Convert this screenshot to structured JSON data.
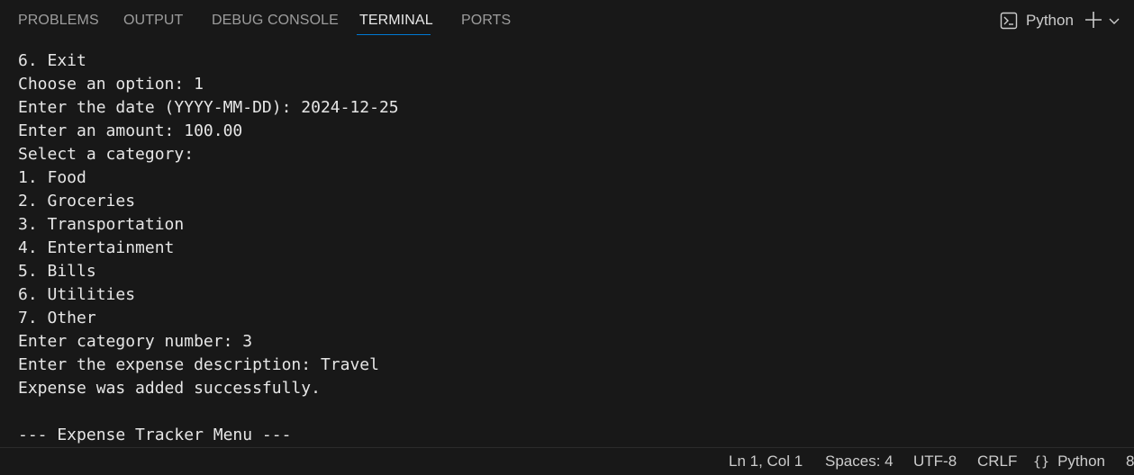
{
  "panel": {
    "tabs": [
      {
        "label": "PROBLEMS"
      },
      {
        "label": "OUTPUT"
      },
      {
        "label": "DEBUG CONSOLE"
      },
      {
        "label": "TERMINAL"
      },
      {
        "label": "PORTS"
      }
    ],
    "active_tab": "TERMINAL",
    "terminal_name": "Python",
    "terminal_icon": "terminal-icon",
    "add_icon": "plus-icon",
    "dropdown_icon": "chevron-down-icon"
  },
  "terminal": {
    "lines": [
      "6. Exit",
      "Choose an option: 1",
      "Enter the date (YYYY-MM-DD): 2024-12-25",
      "Enter an amount: 100.00",
      "Select a category:",
      "1. Food",
      "2. Groceries",
      "3. Transportation",
      "4. Entertainment",
      "5. Bills",
      "6. Utilities",
      "7. Other",
      "Enter category number: 3",
      "Enter the expense description: Travel",
      "Expense was added successfully.",
      "",
      "--- Expense Tracker Menu ---"
    ]
  },
  "status_bar": {
    "position": "Ln 1, Col 1",
    "spaces": "Spaces: 4",
    "encoding": "UTF-8",
    "eol": "CRLF",
    "language_icon": "{}",
    "language": "Python",
    "overflow_glyph": "8"
  },
  "colors": {
    "background": "#181818",
    "accent": "#0078d4",
    "text": "#cccccc"
  }
}
